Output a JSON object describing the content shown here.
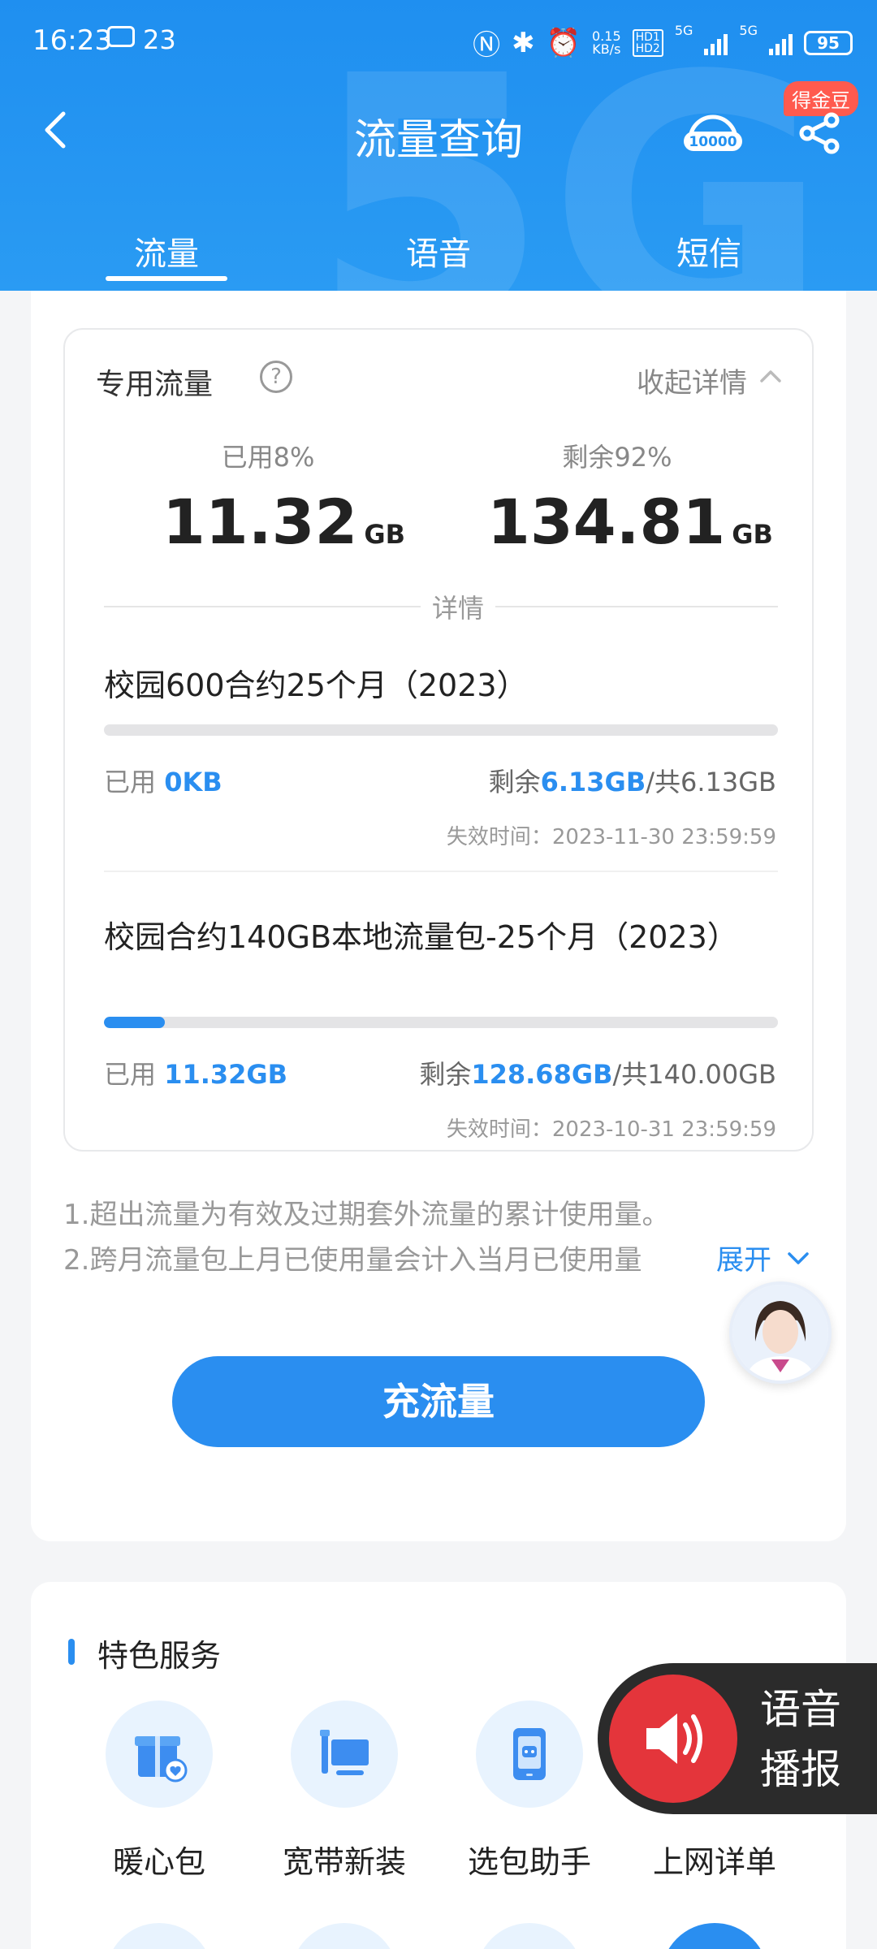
{
  "status_bar": {
    "time": "16:23",
    "notif_count": "23",
    "speed_value": "0.15",
    "speed_unit": "KB/s",
    "hd1": "HD1",
    "hd2": "HD2",
    "net1": "5G",
    "net2": "5G",
    "battery": "95"
  },
  "nav": {
    "title": "流量查询",
    "badge": "得金豆",
    "hotline": "10000"
  },
  "tabs": [
    {
      "label": "流量"
    },
    {
      "label": "语音"
    },
    {
      "label": "短信"
    }
  ],
  "summary": {
    "title": "专用流量",
    "help": "?",
    "collapse": "收起详情",
    "used_label": "已用8%",
    "used_value": "11.32",
    "used_unit": "GB",
    "remain_label": "剩余92%",
    "remain_value": "134.81",
    "remain_unit": "GB",
    "details_label": "详情"
  },
  "packages": [
    {
      "name": "校园600合约25个月（2023）",
      "progress": 0,
      "used_prefix": "已用 ",
      "used": "0KB",
      "remain_prefix": "剩余",
      "remain": "6.13GB",
      "total": "/共6.13GB",
      "expire": "失效时间：2023-11-30 23:59:59"
    },
    {
      "name": "校园合约140GB本地流量包-25个月（2023）",
      "progress": 0.09,
      "used_prefix": "已用 ",
      "used": "11.32GB",
      "remain_prefix": "剩余",
      "remain": "128.68GB",
      "total": "/共140.00GB",
      "expire": "失效时间：2023-10-31 23:59:59"
    }
  ],
  "notes": {
    "line1": "1.超出流量为有效及过期套外流量的累计使用量。",
    "line2": "2.跨月流量包上月已使用量会计入当月已使用量",
    "expand": "展开"
  },
  "recharge_label": "充流量",
  "services": {
    "title": "特色服务",
    "items": [
      {
        "label": "暖心包",
        "icon": "gift-heart-icon"
      },
      {
        "label": "宽带新装",
        "icon": "monitor-icon"
      },
      {
        "label": "选包助手",
        "icon": "robot-phone-icon"
      },
      {
        "label": "上网详单",
        "icon": "list-icon"
      }
    ]
  },
  "voice": {
    "line1": "语音",
    "line2": "播报"
  },
  "colors": {
    "primary": "#2a8ef0",
    "header": "#2291f1",
    "badge": "#ff5a4e",
    "voice_btn": "#e4353b"
  }
}
